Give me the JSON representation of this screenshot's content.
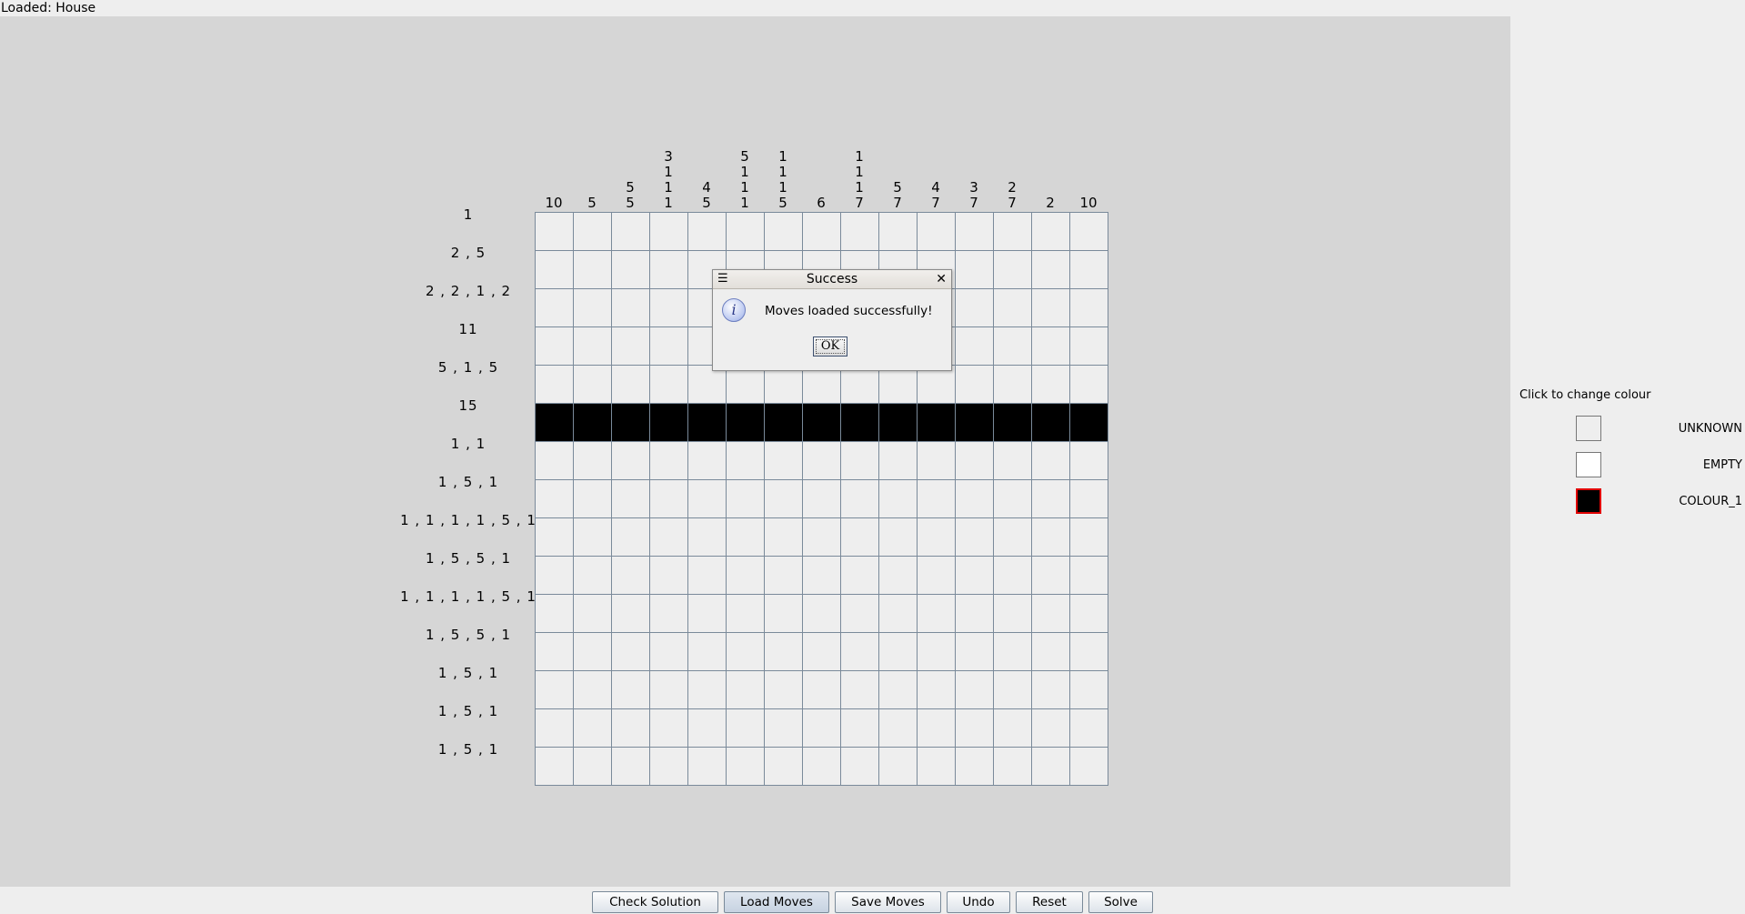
{
  "status_text": "Loaded: House",
  "column_clues": [
    [
      "10"
    ],
    [
      "5"
    ],
    [
      "5",
      "5"
    ],
    [
      "3",
      "1",
      "1",
      "1"
    ],
    [
      "4",
      "5"
    ],
    [
      "5",
      "1",
      "1",
      "1"
    ],
    [
      "1",
      "1",
      "1",
      "5"
    ],
    [
      "6"
    ],
    [
      "1",
      "1",
      "1",
      "7"
    ],
    [
      "5",
      "7"
    ],
    [
      "4",
      "7"
    ],
    [
      "3",
      "7"
    ],
    [
      "2",
      "7"
    ],
    [
      "2"
    ],
    [
      "10"
    ]
  ],
  "row_clues": [
    "1",
    "2 , 5",
    "2 , 2 , 1 , 2",
    "11",
    "5 , 1 , 5",
    "15",
    "1 , 1",
    "1 , 5 , 1",
    "1 , 1 , 1 , 1 , 5 , 1",
    "1 , 5 , 5 , 1",
    "1 , 1 , 1 , 1 , 5 , 1",
    "1 , 5 , 5 , 1",
    "1 , 5 , 1",
    "1 , 5 , 1",
    "1 , 5 , 1"
  ],
  "grid": {
    "size": 15,
    "filled_rows": [
      5
    ]
  },
  "dialog": {
    "title": "Success",
    "menu_icon": "☰",
    "close_icon": "✕",
    "icon": "information-icon",
    "message": "Moves loaded successfully!",
    "ok_label": "OK"
  },
  "colour_panel": {
    "heading": "Click to change colour",
    "options": [
      {
        "label": "UNKNOWN",
        "color": "#eeeeee",
        "border": "#777777",
        "selected": false
      },
      {
        "label": "EMPTY",
        "color": "#ffffff",
        "border": "#777777",
        "selected": false
      },
      {
        "label": "COLOUR_1",
        "color": "#000000",
        "border": "#e00000",
        "selected": true
      }
    ]
  },
  "buttons": {
    "check_solution": "Check Solution",
    "load_moves": "Load Moves",
    "save_moves": "Save Moves",
    "undo": "Undo",
    "reset": "Reset",
    "solve": "Solve"
  }
}
